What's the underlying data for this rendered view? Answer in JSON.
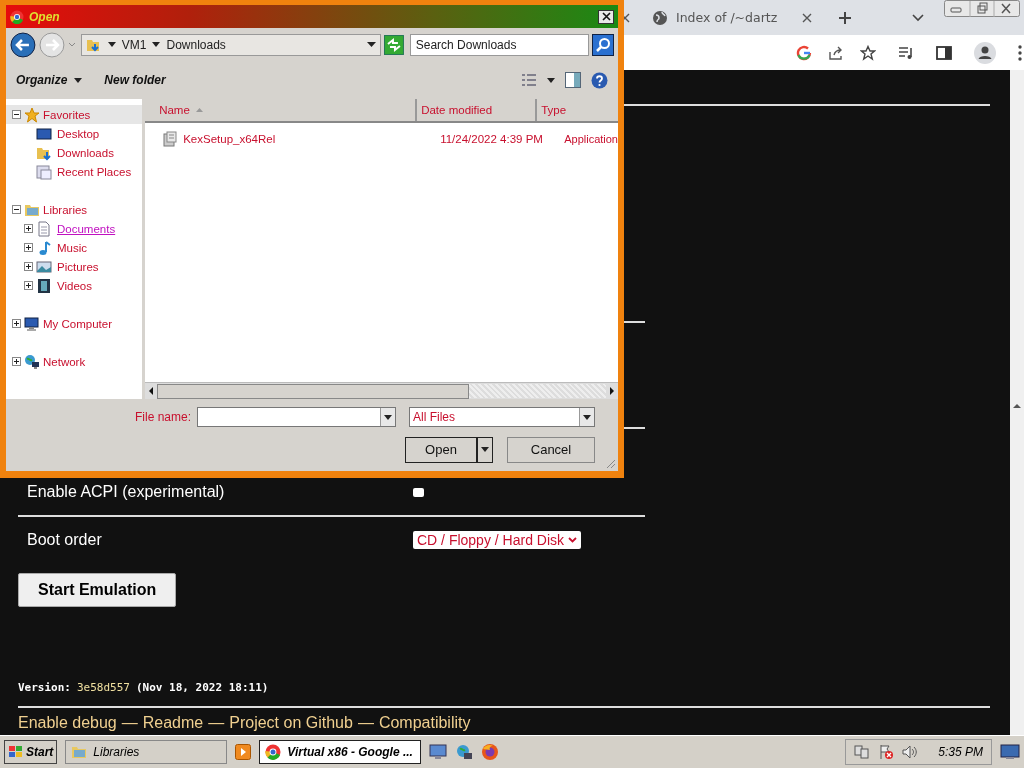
{
  "browser": {
    "tabs": [
      {
        "title": "Index of /~dartz",
        "selected": false
      }
    ]
  },
  "page": {
    "rows": [
      {
        "kind": "checkbox",
        "label": "Enable ACPI (experimental)",
        "checked": false
      },
      {
        "kind": "select",
        "label": "Boot order",
        "value": "CD / Floppy / Hard Disk"
      }
    ],
    "start_button": "Start Emulation",
    "version_label": "Version:",
    "version_hash": "3e58d557",
    "version_date": "(Nov 18, 2022 18:11)",
    "footer_links": [
      "Enable debug",
      "Readme",
      "Project on Github",
      "Compatibility"
    ],
    "footer_separator": "—"
  },
  "dialog": {
    "title": "Open",
    "breadcrumb": [
      "VM1",
      "Downloads"
    ],
    "search": {
      "placeholder": "Search Downloads"
    },
    "commands": [
      {
        "label": "Organize",
        "dropdown": true
      },
      {
        "label": "New folder",
        "dropdown": false
      }
    ],
    "nav_tree": [
      {
        "label": "Favorites",
        "expanded": true,
        "children": [
          {
            "label": "Desktop",
            "hovered": false
          },
          {
            "label": "Downloads",
            "hovered": false
          },
          {
            "label": "Recent Places",
            "hovered": false
          }
        ]
      },
      {
        "label": "Libraries",
        "expanded": true,
        "children": [
          {
            "label": "Documents",
            "expanded": false,
            "hovered": true
          },
          {
            "label": "Music",
            "expanded": false,
            "hovered": false
          },
          {
            "label": "Pictures",
            "expanded": false,
            "hovered": false
          },
          {
            "label": "Videos",
            "expanded": false,
            "hovered": false
          }
        ]
      },
      {
        "label": "My Computer",
        "expanded": false
      },
      {
        "label": "Network",
        "expanded": false
      }
    ],
    "columns": [
      {
        "label": "Name",
        "sorted": true
      },
      {
        "label": "Date modified",
        "sorted": false
      },
      {
        "label": "Type",
        "sorted": false
      }
    ],
    "files": [
      {
        "name": "KexSetup_x64Rel",
        "date": "11/24/2022 4:39 PM",
        "type": "Application"
      }
    ],
    "file_name_label": "File name:",
    "file_type": "All Files",
    "buttons": [
      "Open",
      "Cancel"
    ]
  },
  "taskbar": {
    "start": "Start",
    "tasks": [
      {
        "label": "Libraries",
        "selected": false
      },
      {
        "label": "Virtual x86 - Google ...",
        "selected": true
      }
    ],
    "clock": "5:35 PM"
  }
}
